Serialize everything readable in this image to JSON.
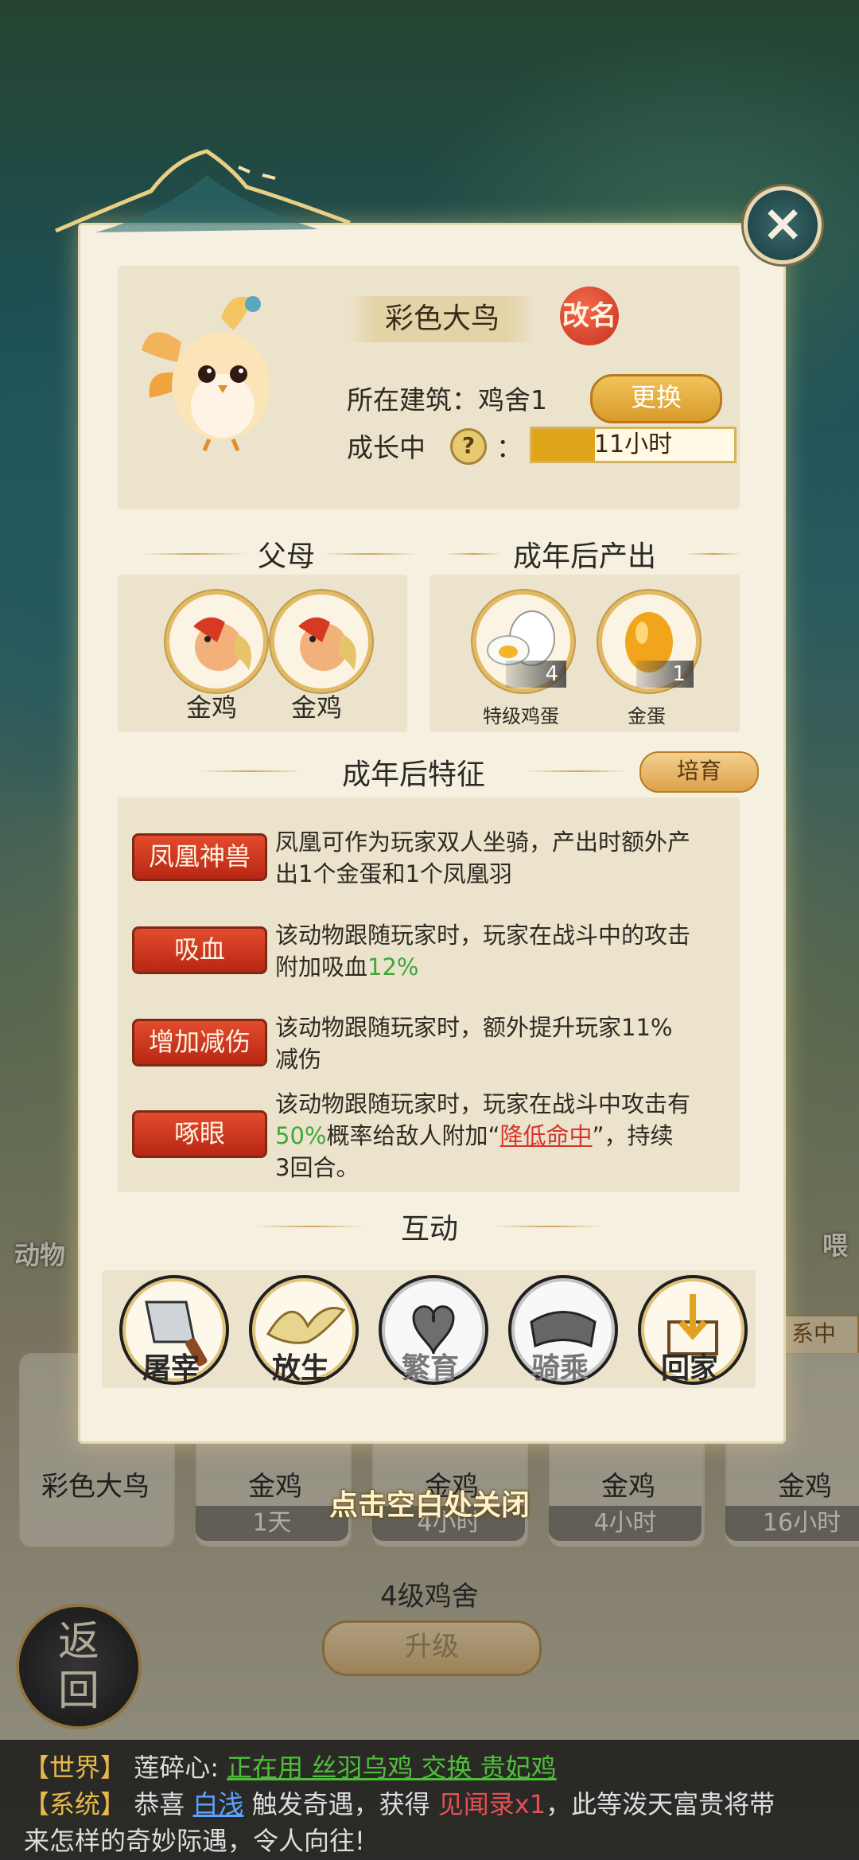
{
  "pet": {
    "name": "彩色大鸟",
    "rename_label": "改名",
    "building_label": "所在建筑：鸡舍1",
    "swap_label": "更换",
    "growth_label": "成长中",
    "question_mark": "?",
    "colon": "：",
    "growth_time": "11小时",
    "growth_progress_fraction": 0.31
  },
  "parents": {
    "title": "父母",
    "items": [
      {
        "name": "金鸡",
        "icon": "golden-rooster-icon"
      },
      {
        "name": "金鸡",
        "icon": "golden-rooster-icon"
      }
    ]
  },
  "output": {
    "title": "成年后产出",
    "items": [
      {
        "name": "特级鸡蛋",
        "count": "4",
        "icon": "premium-egg-icon"
      },
      {
        "name": "金蛋",
        "count": "1",
        "icon": "golden-egg-icon"
      }
    ]
  },
  "traits": {
    "title": "成年后特征",
    "breed_label": "培育",
    "items": [
      {
        "tag": "凤凰神兽",
        "line1": "凤凰可作为玩家双人坐骑，产出时额外产",
        "line2": "出1个金蛋和1个凤凰羽"
      },
      {
        "tag": "吸血",
        "line1": "该动物跟随玩家时，玩家在战斗中的攻击",
        "line2_pre": "附加吸血",
        "line2_val": "12%"
      },
      {
        "tag": "增加减伤",
        "line1": "该动物跟随玩家时，额外提升玩家11%",
        "line2": "减伤"
      },
      {
        "tag": "啄眼",
        "line1": "该动物跟随玩家时，玩家在战斗中攻击有",
        "line2_val": "50%",
        "line2_mid": "概率给敌人附加“",
        "line2_link": "降低命中",
        "line2_post": "”，持续",
        "line3": "3回合。"
      }
    ]
  },
  "interact": {
    "title": "互动",
    "items": [
      {
        "label": "屠宰",
        "icon": "cleaver-icon"
      },
      {
        "label": "放生",
        "icon": "bird-icon"
      },
      {
        "label": "繁育",
        "icon": "hearts-icon"
      },
      {
        "label": "骑乘",
        "icon": "saddle-icon"
      },
      {
        "label": "回家",
        "icon": "home-arrow-icon"
      }
    ]
  },
  "close_hint": "点击空白处关闭",
  "background": {
    "cards": [
      {
        "name": "彩色大鸟",
        "time": ""
      },
      {
        "name": "金鸡",
        "time": "1天"
      },
      {
        "name": "金鸡",
        "time": "4小时"
      },
      {
        "name": "金鸡",
        "time": "4小时"
      },
      {
        "name": "金鸡",
        "time": "16小时"
      }
    ],
    "coop_label": "4级鸡舍",
    "upgrade_label": "升级",
    "back_label_1": "返",
    "back_label_2": "回",
    "side_left": "动物",
    "side_right": "喂",
    "side_chip": "系中"
  },
  "chat": {
    "line1_tag": "【世界】",
    "line1_user": "莲碎心:",
    "line1_msg": "正在用 丝羽乌鸡 交换 贵妃鸡",
    "line2_tag": "【系统】",
    "line2_pre": "恭喜",
    "line2_user": "白浅",
    "line2_mid": "触发奇遇，获得",
    "line2_item": "见闻录x1",
    "line2_post": "，此等泼天富贵将带",
    "line3": "来怎样的奇妙际遇，令人向往!"
  },
  "colors": {
    "accent_gold": "#d99a2b",
    "trait_red": "#c8301f",
    "value_green": "#3fa63c",
    "panel_bg": "#f6f0e1"
  }
}
